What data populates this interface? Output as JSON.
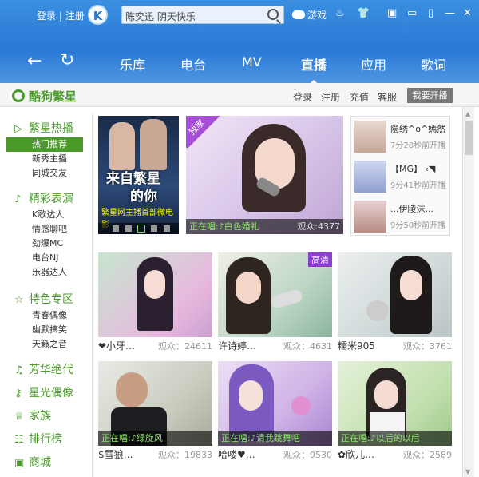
{
  "top": {
    "login": "登录",
    "register": "注册",
    "divider": "|",
    "logo": "K",
    "search_value": "陈奕迅 阴天快乐",
    "game": "游戏"
  },
  "nav": {
    "tabs": [
      "乐库",
      "电台",
      "MV",
      "直播",
      "应用",
      "歌词"
    ],
    "active": "直播"
  },
  "subhead": {
    "brand": "酷狗繁星",
    "links": [
      "登录",
      "注册",
      "充值",
      "客服"
    ],
    "golive": "我要开播"
  },
  "sidebar": [
    {
      "title": "繁星热播",
      "icon": "play-icon",
      "items": [
        "热门推荐",
        "新秀主播",
        "同城交友"
      ],
      "active": 0
    },
    {
      "title": "精彩表演",
      "icon": "music-note-icon",
      "items": [
        "K歌达人",
        "情感聊吧",
        "劲爆MC",
        "电台NJ",
        "乐器达人"
      ]
    },
    {
      "title": "特色专区",
      "icon": "star-icon",
      "items": [
        "青春偶像",
        "幽默搞笑",
        "天籁之音"
      ]
    },
    {
      "title": "芳华绝代",
      "icon": "music-note-icon",
      "items": []
    },
    {
      "title": "星光偶像",
      "icon": "key-icon",
      "items": []
    },
    {
      "title": "家族",
      "icon": "trophy-icon",
      "items": []
    },
    {
      "title": "排行榜",
      "icon": "ranking-icon",
      "items": []
    },
    {
      "title": "商城",
      "icon": "shop-icon",
      "items": []
    }
  ],
  "banner": {
    "title_line1": "来自繁星",
    "title_line2": "的你",
    "subtitle": "繁星网主播首部微电影"
  },
  "featured": {
    "badge": "独家",
    "status": "正在唱:♪白色婚礼",
    "viewers": "观众:4377"
  },
  "recent": [
    {
      "name": "隐绣^o^嫣然",
      "time": "7分28秒前开播"
    },
    {
      "name": "【MG】 ‹◥",
      "time": "9分41秒前开播"
    },
    {
      "name": "...伊陵沫...",
      "time": "9分50秒前开播"
    }
  ],
  "grid": [
    {
      "name": "❤小牙…",
      "viewers": "观众：24611"
    },
    {
      "name": "许诗婷…",
      "viewers": "观众：4631",
      "badge": "高清"
    },
    {
      "name": "糯米905",
      "viewers": "观众：3761"
    },
    {
      "name": "$雪狼…",
      "viewers": "观众：19833",
      "status": "正在唱:♪绿旋风"
    },
    {
      "name": "哈喽♥…",
      "viewers": "观众：9530",
      "status": "正在唱:♪请我跳舞吧"
    },
    {
      "name": "✿欣儿…",
      "viewers": "观众：2589",
      "status": "正在唱:♪以后的以后"
    }
  ],
  "colors": {
    "header": "#2a7ad6",
    "accent": "#4a9a2a",
    "badge": "#8b3fd1"
  }
}
